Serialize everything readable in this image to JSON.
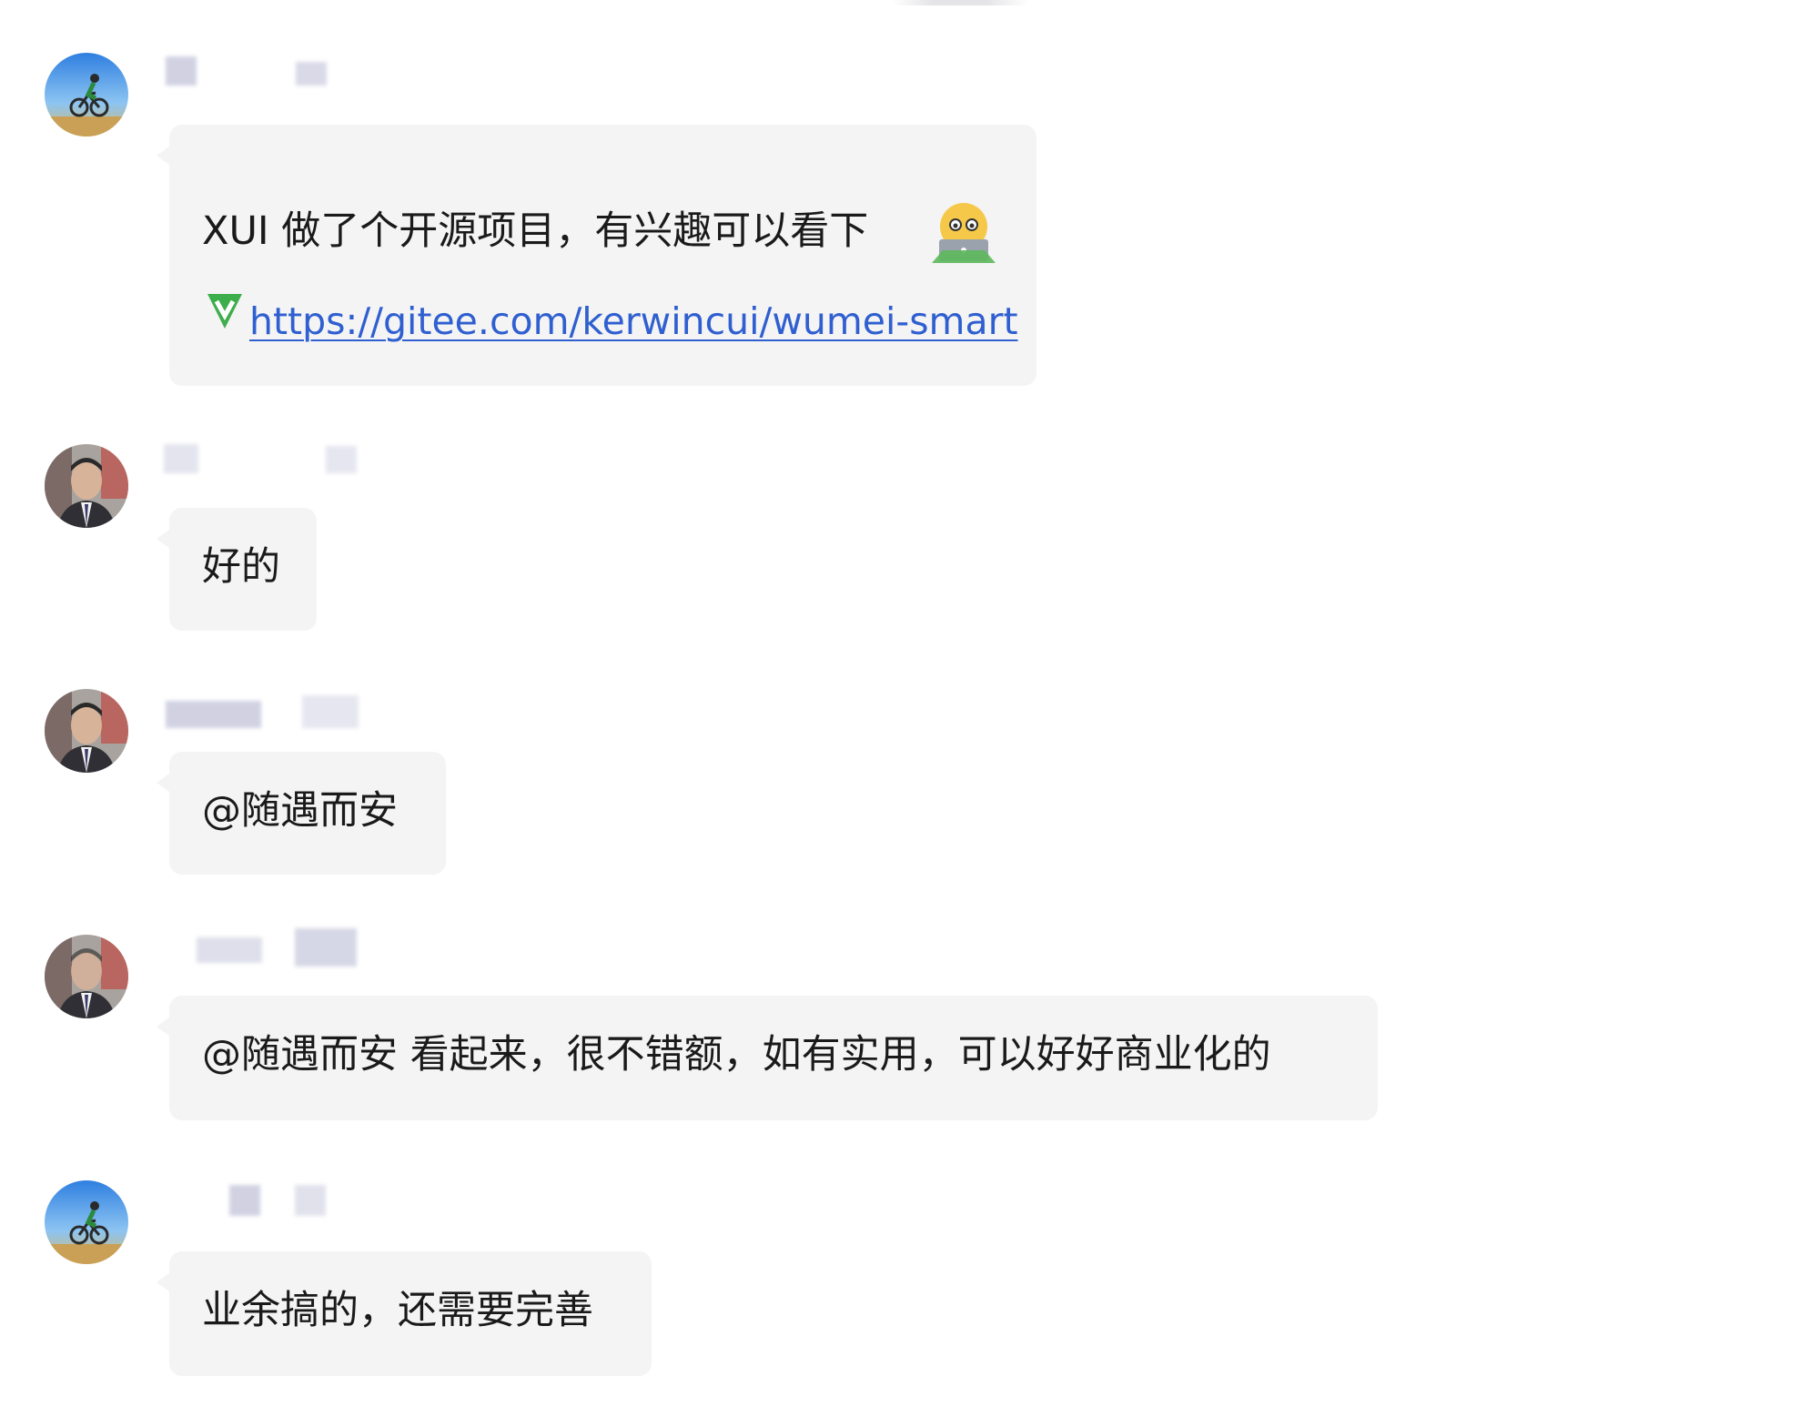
{
  "messages": [
    {
      "sender": "",
      "avatar": "cyclist-avatar-icon",
      "lines": [
        "XUI 做了个开源项目，有兴趣可以看下"
      ],
      "emoji": "laptop-emoji-icon",
      "link_icon": "gitee-icon",
      "link": "https://gitee.com/kerwincui/wumei-smart"
    },
    {
      "sender": "",
      "avatar": "man-portrait-avatar-icon",
      "text": "好的"
    },
    {
      "sender": "",
      "avatar": "man-portrait-avatar-icon",
      "text": "@随遇而安"
    },
    {
      "sender": "",
      "avatar": "man-portrait-avatar-icon",
      "text": "@随遇而安 看起来，很不错额，如有实用，可以好好商业化的"
    },
    {
      "sender": "",
      "avatar": "cyclist-avatar-icon",
      "text": "业余搞的，还需要完善"
    }
  ],
  "colors": {
    "bubble_background": "#f4f4f4",
    "link": "#2f5fd0",
    "text": "#1a1a1a",
    "gitee_green": "#3dae4c"
  }
}
